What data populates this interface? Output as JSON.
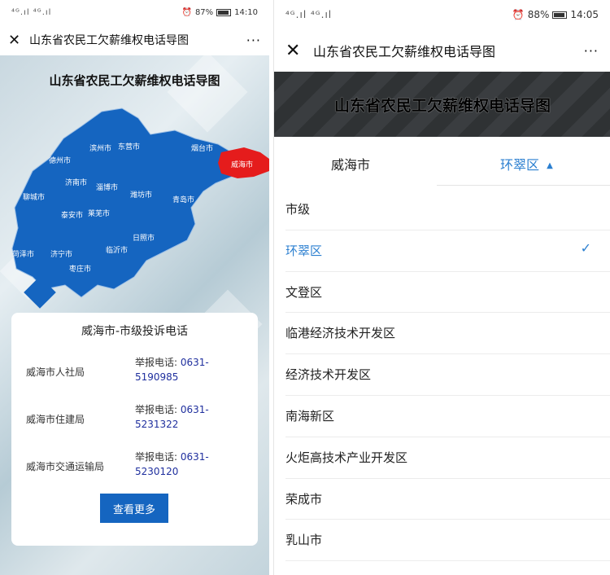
{
  "left": {
    "status": {
      "signal": "⁴ᴳ.ıl ⁴ᴳ.ıl",
      "battery": "87%",
      "time": "14:10"
    },
    "nav": {
      "close": "✕",
      "title": "山东省农民工欠薪维权电话导图",
      "more": "···"
    },
    "map_title": "山东省农民工欠薪维权电话导图",
    "map_labels": [
      "德州市",
      "滨州市",
      "东营市",
      "烟台市",
      "威海市",
      "济南市",
      "淄博市",
      "潍坊市",
      "青岛市",
      "聊城市",
      "泰安市",
      "莱芜市",
      "日照市",
      "临沂市",
      "菏泽市",
      "济宁市",
      "枣庄市"
    ],
    "card": {
      "title": "威海市-市级投诉电话",
      "rows": [
        {
          "dept": "威海市人社局",
          "prefix": "举报电话:",
          "number": "0631-5190985"
        },
        {
          "dept": "威海市住建局",
          "prefix": "举报电话:",
          "number": "0631-5231322"
        },
        {
          "dept": "威海市交通运输局",
          "prefix": "举报电话:",
          "number": "0631-5230120"
        }
      ],
      "button": "查看更多"
    }
  },
  "right": {
    "status": {
      "signal": "⁴ᴳ.ıl ⁴ᴳ.ıl",
      "battery": "88%",
      "time": "14:05"
    },
    "nav": {
      "close": "✕",
      "title": "山东省农民工欠薪维权电话导图",
      "more": "···"
    },
    "banner": "山东省农民工欠薪维权电话导图",
    "filter": {
      "city": "威海市",
      "district": "环翠区",
      "arrow": "▲"
    },
    "options": [
      "市级",
      "环翠区",
      "文登区",
      "临港经济技术开发区",
      "经济技术开发区",
      "南海新区",
      "火炬高技术产业开发区",
      "荣成市",
      "乳山市"
    ],
    "selected": "环翠区",
    "check": "✓"
  },
  "colors": {
    "map_blue": "#1565c0",
    "highlight_red": "#e51c1c",
    "accent": "#2b7fd0",
    "button": "#1565c0"
  }
}
